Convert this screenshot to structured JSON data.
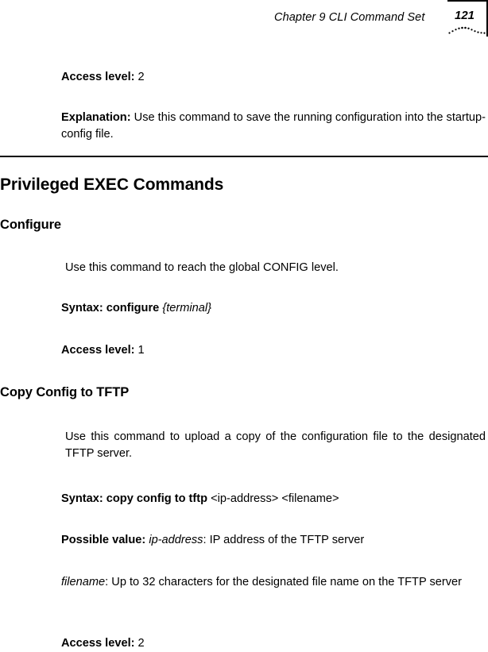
{
  "header": {
    "chapter_title": "Chapter 9 CLI Command Set",
    "page_number": "121"
  },
  "body": {
    "access_level_label_1": "Access level:",
    "access_level_value_1": " 2",
    "explanation_label": "Explanation:",
    "explanation_text": " Use this command to save the running configuration into the startup-config file.",
    "section_heading": "Privileged EXEC Commands",
    "configure_heading": "Configure",
    "configure_description": "Use this command to reach the global CONFIG level.",
    "configure_syntax_label": "Syntax: configure",
    "configure_syntax_arg": "{terminal}",
    "access_level_label_2": "Access level:",
    "access_level_value_2": " 1",
    "copy_config_heading": "Copy Config to TFTP",
    "copy_config_description": "Use this command to upload a copy of the configuration file to the designated TFTP server.",
    "copy_syntax_label": "Syntax: copy config to tftp",
    "copy_syntax_args": " <ip-address> <filename>",
    "possible_value_label": "Possible value:",
    "possible_value_term": "ip-address",
    "possible_value_text": ": IP address of the TFTP server",
    "filename_term": "filename",
    "filename_text": ": Up to 32 characters for the designated file name on the TFTP server",
    "access_level_label_3": "Access level:",
    "access_level_value_3": " 2"
  },
  "style": {
    "text_color": "#000000",
    "page_background": "#ffffff"
  }
}
